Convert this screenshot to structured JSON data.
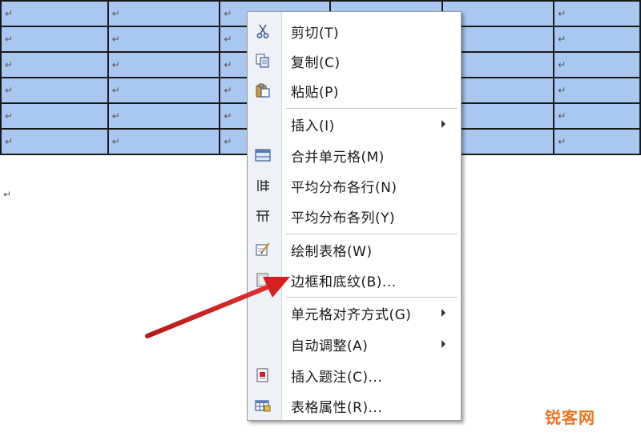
{
  "document": {
    "paragraph_mark": "↵",
    "table": {
      "rows": [
        [
          "↵",
          "↵",
          "↵",
          "",
          "",
          "↵"
        ],
        [
          "↵",
          "↵",
          "↵",
          "",
          "",
          "↵"
        ],
        [
          "↵",
          "↵",
          "↵",
          "",
          "",
          "↵"
        ],
        [
          "↵",
          "↵",
          "↵",
          "",
          "",
          "↵"
        ],
        [
          "↵",
          "↵",
          "↵",
          "",
          "",
          "↵"
        ],
        [
          "↵",
          "↵",
          "↵",
          "",
          "",
          "↵"
        ]
      ],
      "selection_color": "#a8c8f0"
    }
  },
  "context_menu": {
    "items": [
      {
        "label": "剪切(T)",
        "icon": "scissors-icon"
      },
      {
        "label": "复制(C)",
        "icon": "copy-icon"
      },
      {
        "label": "粘贴(P)",
        "icon": "paste-icon"
      },
      {
        "label": "插入(I)",
        "icon": "",
        "submenu": true
      },
      {
        "label": "合并单元格(M)",
        "icon": "merge-cells-icon"
      },
      {
        "label": "平均分布各行(N)",
        "icon": "distribute-rows-icon"
      },
      {
        "label": "平均分布各列(Y)",
        "icon": "distribute-columns-icon"
      },
      {
        "label": "绘制表格(W)",
        "icon": "draw-table-icon"
      },
      {
        "label": "边框和底纹(B)...",
        "icon": "borders-shading-icon"
      },
      {
        "label": "单元格对齐方式(G)",
        "icon": "",
        "submenu": true
      },
      {
        "label": "自动调整(A)",
        "icon": "",
        "submenu": true
      },
      {
        "label": "插入题注(C)...",
        "icon": "insert-caption-icon"
      },
      {
        "label": "表格属性(R)...",
        "icon": "table-properties-icon"
      }
    ]
  },
  "annotation": {
    "arrow_color": "#d42020"
  },
  "watermark": {
    "text": "锐客网"
  }
}
